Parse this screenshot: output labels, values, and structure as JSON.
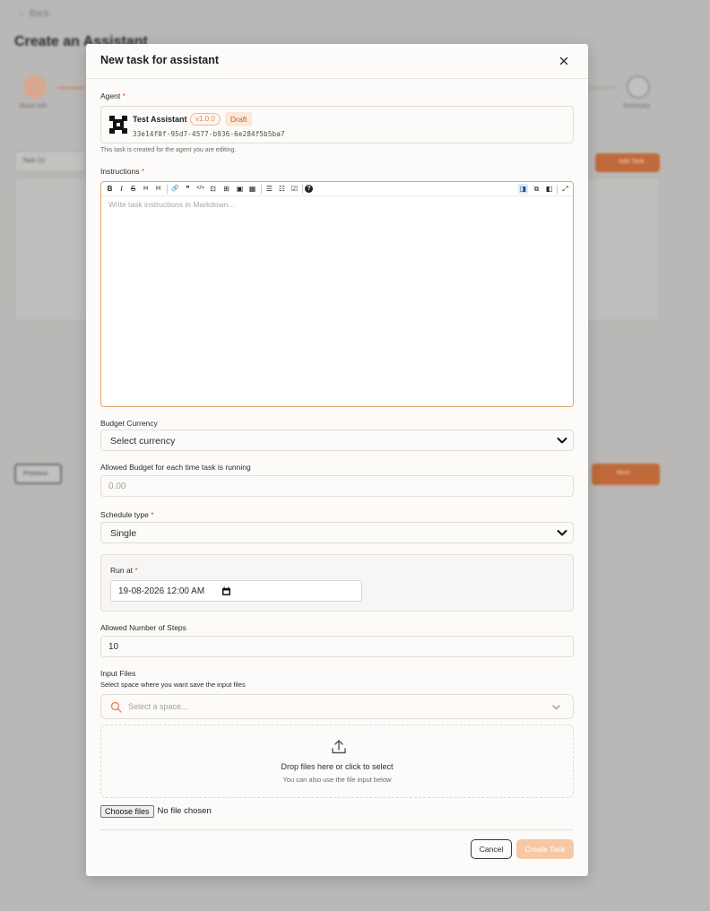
{
  "background": {
    "back_link": "← Back",
    "page_title": "Create an Assistant",
    "step1_label": "Basic info",
    "step5_label": "Summary",
    "task_select": "Task (1)",
    "add_task_label": "Add Task",
    "previous_label": "Previous",
    "next_label": "Next"
  },
  "modal": {
    "title": "New task for assistant",
    "close_symbol": "×"
  },
  "agent": {
    "label": "Agent",
    "required_mark": "*",
    "name": "Test Assistant",
    "version": "v1.0.0",
    "status": "Draft",
    "id": "33e14f0f-95d7-4577-b936-6e284f5b5ba7",
    "helper_text": "This task is created for the agent you are editing."
  },
  "instructions": {
    "label": "Instructions",
    "required_mark": "*",
    "placeholder": "Write task instructions in Markdown...",
    "toolbar": {
      "bold": "B",
      "italic": "I",
      "strike": "S",
      "heading": "H",
      "heading2": "H",
      "link": "🔗",
      "quote": "❞",
      "code": "</>",
      "codeblock": "⊡",
      "image_upload": "⊞",
      "image": "▣",
      "table": "▦",
      "ul": "☰",
      "ol": "☷",
      "checklist": "☑",
      "help": "?",
      "preview_side": "◨",
      "split": "⧉",
      "preview": "◧",
      "fullscreen": "⤢"
    }
  },
  "budget_currency": {
    "label": "Budget Currency",
    "value": "Select currency"
  },
  "allowed_budget": {
    "label": "Allowed Budget for each time task is running",
    "placeholder": "0.00"
  },
  "schedule_type": {
    "label": "Schedule type",
    "required_mark": "*",
    "value": "Single"
  },
  "run_at": {
    "label": "Run at",
    "required_mark": "*",
    "value": "19-08-2026 12:00 AM"
  },
  "steps": {
    "label": "Allowed Number of Steps",
    "value": "10"
  },
  "input_files": {
    "label": "Input Files",
    "sublabel": "Select space where you want save the input files",
    "space_placeholder": "Select a space...",
    "drop_main": "Drop files here or click to select",
    "drop_sub": "You can also use the file input below",
    "choose_label": "Choose files",
    "no_file_text": "No file chosen"
  },
  "footer": {
    "cancel_label": "Cancel",
    "create_label": "Create Task"
  },
  "colors": {
    "accent": "#f7c8a6",
    "focus_border": "#e3a66b",
    "required": "#e44a3a"
  },
  "icons": [
    "close-icon",
    "agent-logo-icon",
    "chevron-down-icon",
    "calendar-icon",
    "search-icon",
    "upload-icon"
  ]
}
